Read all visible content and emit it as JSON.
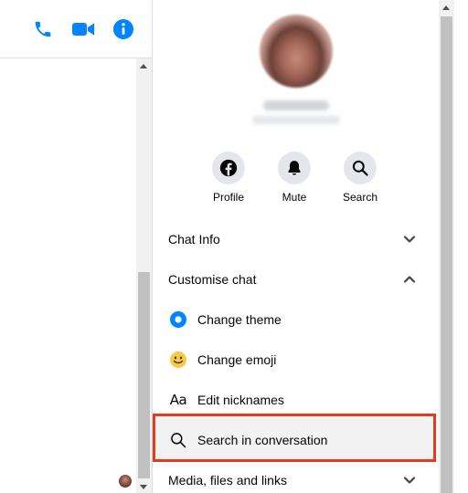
{
  "colors": {
    "accent": "#0084ff",
    "highlight_border": "#e53a1e",
    "icon_bg": "#e4e6eb",
    "emoji_yellow": "#f7c948"
  },
  "chat_header": {
    "icons": [
      "phone-icon",
      "video-camera-icon",
      "info-icon"
    ]
  },
  "info_panel": {
    "actions": [
      {
        "label": "Profile",
        "icon": "facebook-icon"
      },
      {
        "label": "Mute",
        "icon": "bell-icon"
      },
      {
        "label": "Search",
        "icon": "search-icon"
      }
    ],
    "sections": [
      {
        "label": "Chat Info",
        "state": "collapsed"
      },
      {
        "label": "Customise chat",
        "state": "expanded"
      }
    ],
    "customise_items": [
      {
        "label": "Change theme",
        "icon": "theme-dot-icon"
      },
      {
        "label": "Change emoji",
        "icon": "smiley-emoji-icon"
      },
      {
        "label": "Edit nicknames",
        "icon": "text-aa-icon",
        "glyph": "Aa"
      },
      {
        "label": "Search in conversation",
        "icon": "search-icon",
        "highlighted": true
      }
    ],
    "media_section": {
      "label": "Media, files and links",
      "state": "collapsed"
    }
  }
}
